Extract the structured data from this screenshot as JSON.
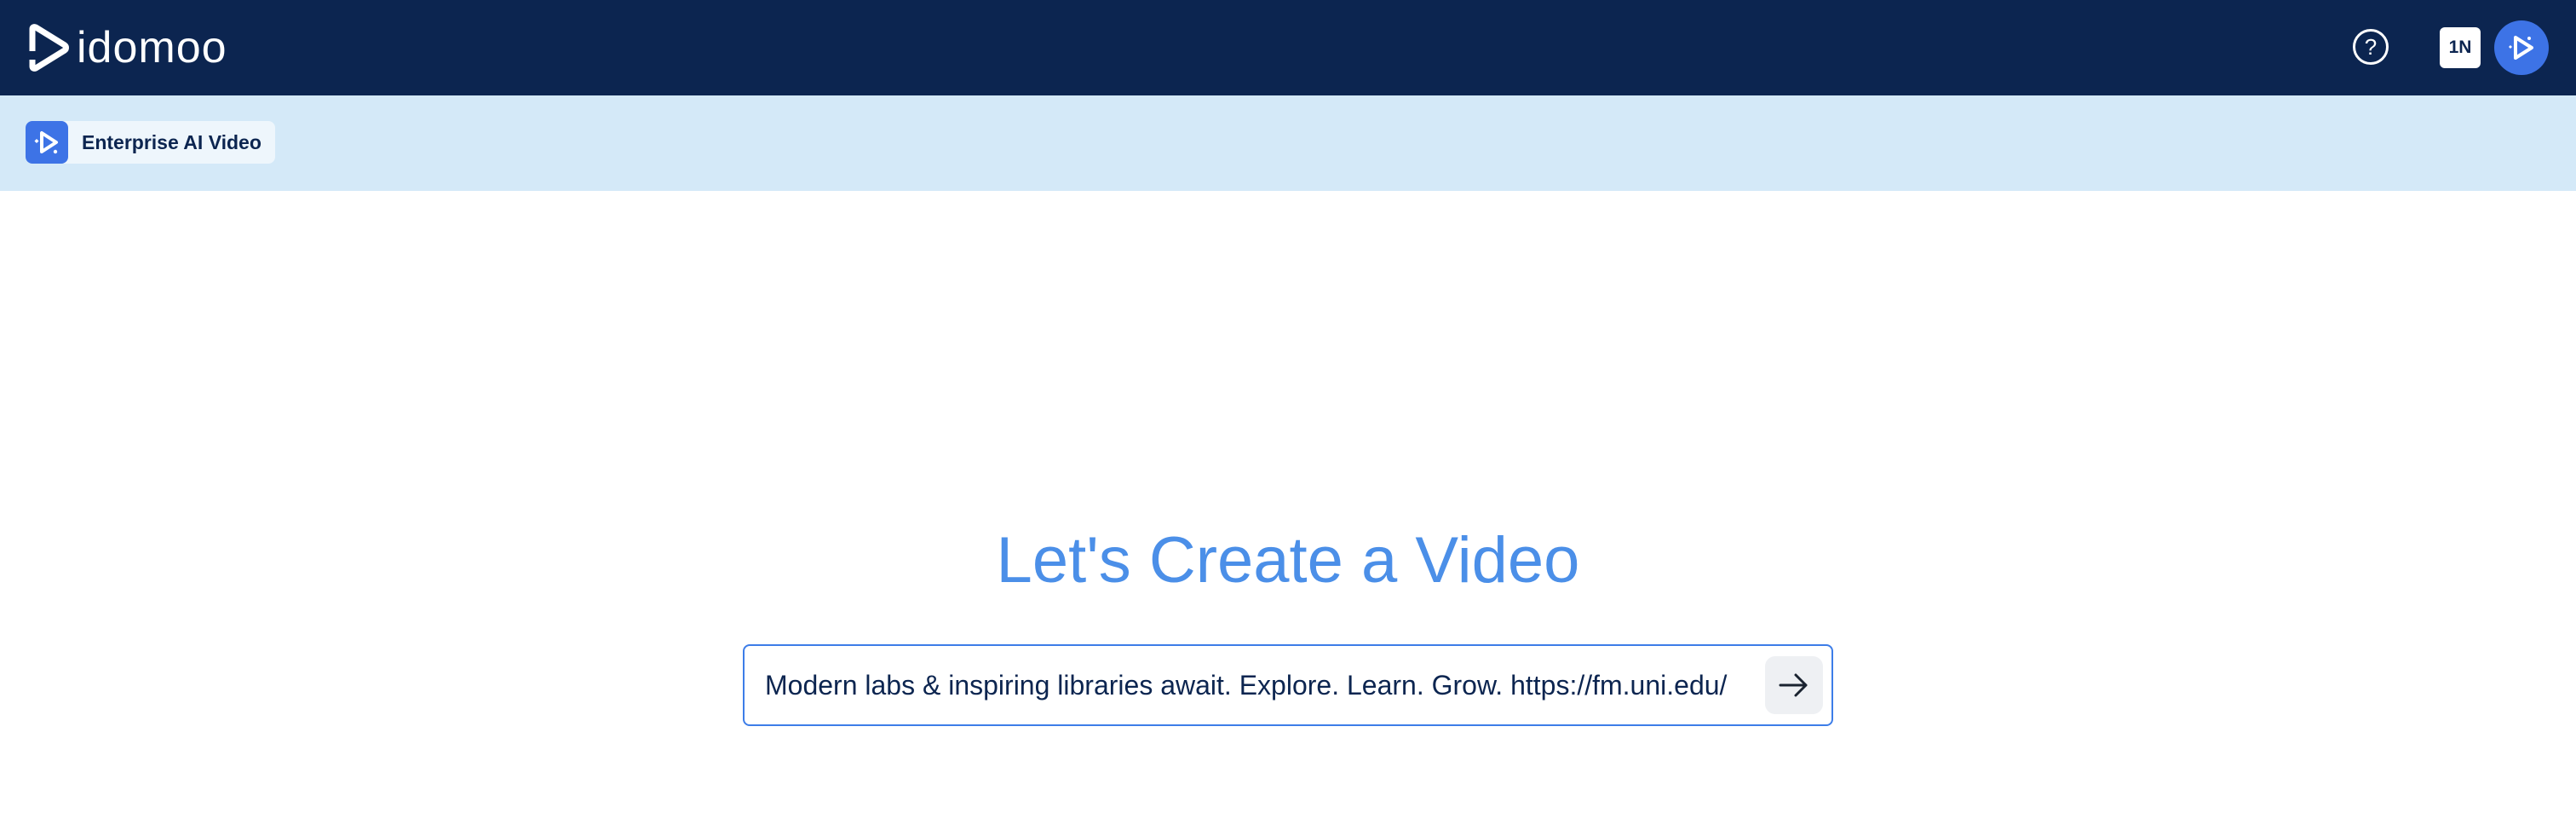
{
  "header": {
    "logo_text": "idomoo",
    "help_icon": "question-circle-icon",
    "org_badge": "1N",
    "avatar_icon": "play-sparkle-icon"
  },
  "subheader": {
    "product_label": "Enterprise AI Video",
    "product_icon": "play-sparkle-icon"
  },
  "main": {
    "title": "Let's Create a Video",
    "prompt": {
      "value": "Modern labs & inspiring libraries await. Explore. Learn. Grow. https://fm.uni.edu/",
      "submit_icon": "arrow-right-icon"
    }
  },
  "colors": {
    "topbar": "#0c2550",
    "subbar": "#d4e9f8",
    "accent": "#3d73e6",
    "title": "#4b8fe8"
  }
}
